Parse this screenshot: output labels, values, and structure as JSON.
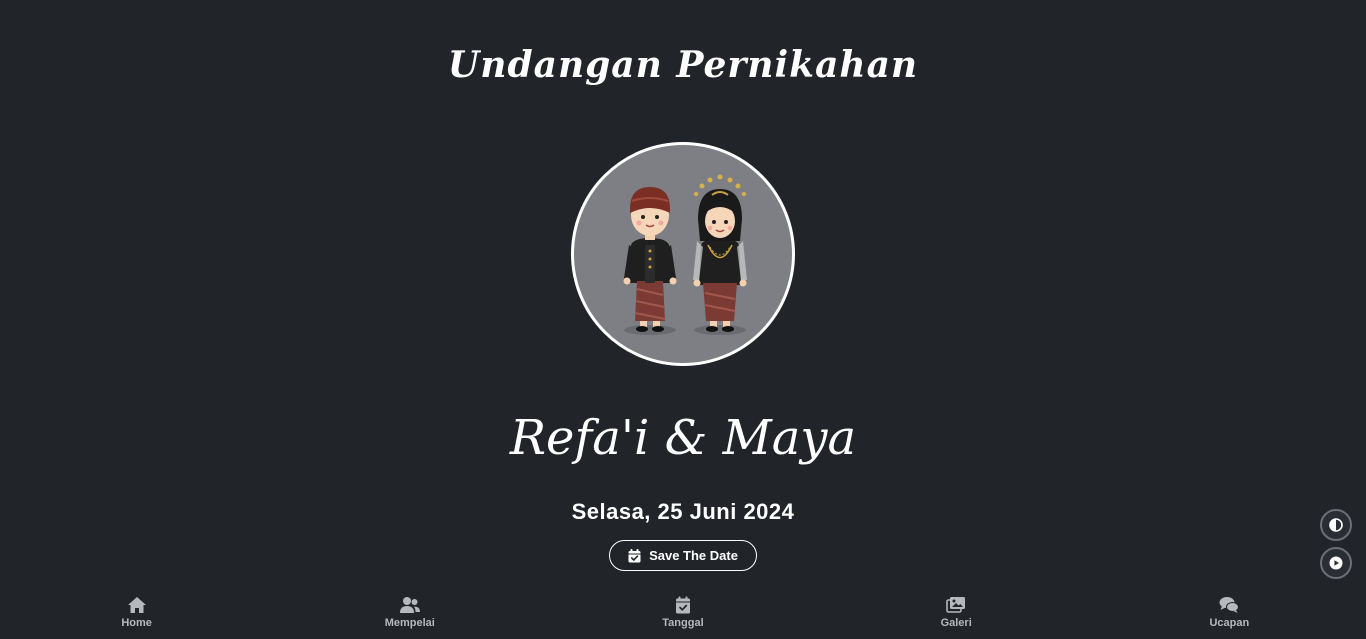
{
  "header": {
    "title": "Undangan Pernikahan"
  },
  "couple": {
    "names": "Refa'i & Maya"
  },
  "event": {
    "date": "Selasa, 25 Juni 2024"
  },
  "save_button": {
    "label": "Save The Date",
    "icon": "calendar-check-icon"
  },
  "floating": {
    "theme_icon": "circle-half-icon",
    "music_icon": "play-circle-icon"
  },
  "nav": {
    "items": [
      {
        "label": "Home",
        "icon": "home-icon"
      },
      {
        "label": "Mempelai",
        "icon": "users-icon"
      },
      {
        "label": "Tanggal",
        "icon": "calendar-check-icon"
      },
      {
        "label": "Galeri",
        "icon": "images-icon"
      },
      {
        "label": "Ucapan",
        "icon": "comments-icon"
      }
    ]
  },
  "colors": {
    "background": "#212429",
    "text": "#ffffff",
    "nav_text": "#b6b8bc",
    "portrait_bg": "#7e7f84"
  }
}
